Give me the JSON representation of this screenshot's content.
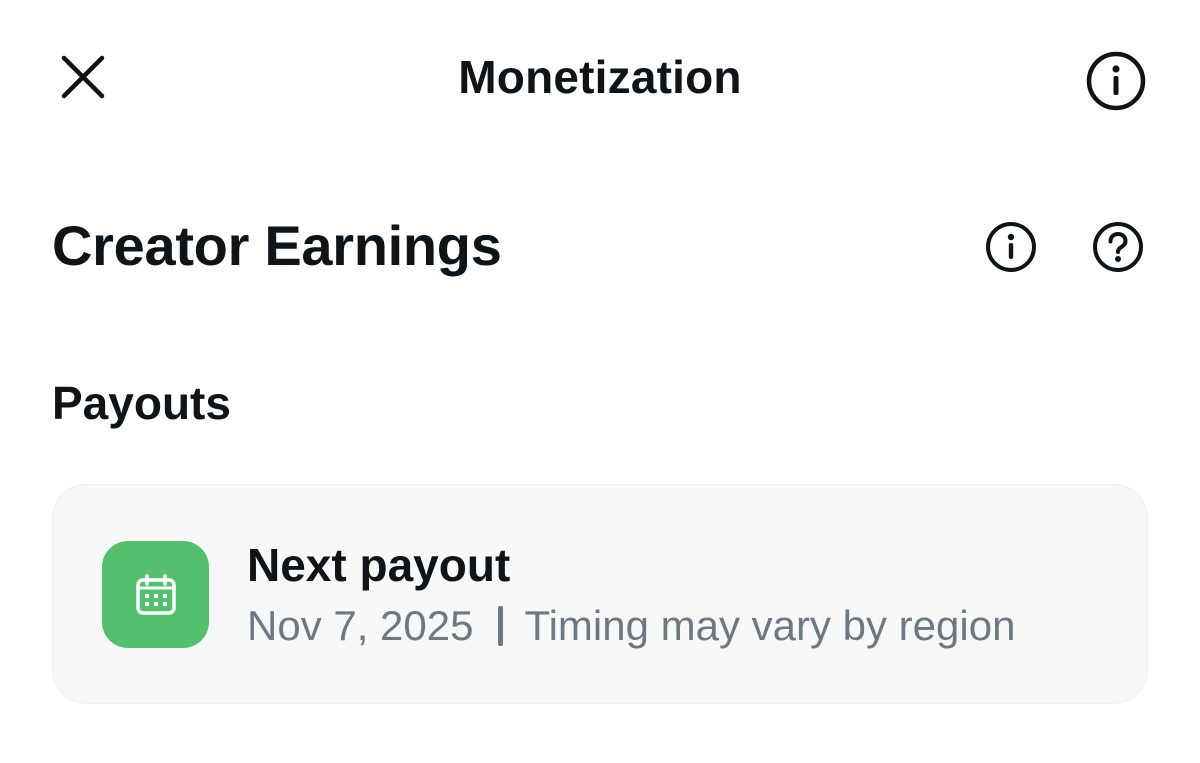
{
  "header": {
    "title": "Monetization",
    "close_icon": "close-icon",
    "info_icon": "info-circle-icon"
  },
  "section": {
    "title": "Creator Earnings",
    "info_icon": "info-circle-icon",
    "help_icon": "question-circle-icon"
  },
  "payouts": {
    "label": "Payouts",
    "next_payout": {
      "title": "Next payout",
      "date": "Nov 7, 2025",
      "note": "Timing may vary by region",
      "icon": "calendar-icon",
      "icon_bg": "#54c06d"
    }
  },
  "colors": {
    "text_primary": "#0f1419",
    "text_secondary": "#6e7883",
    "card_bg": "#f7f9f9"
  }
}
